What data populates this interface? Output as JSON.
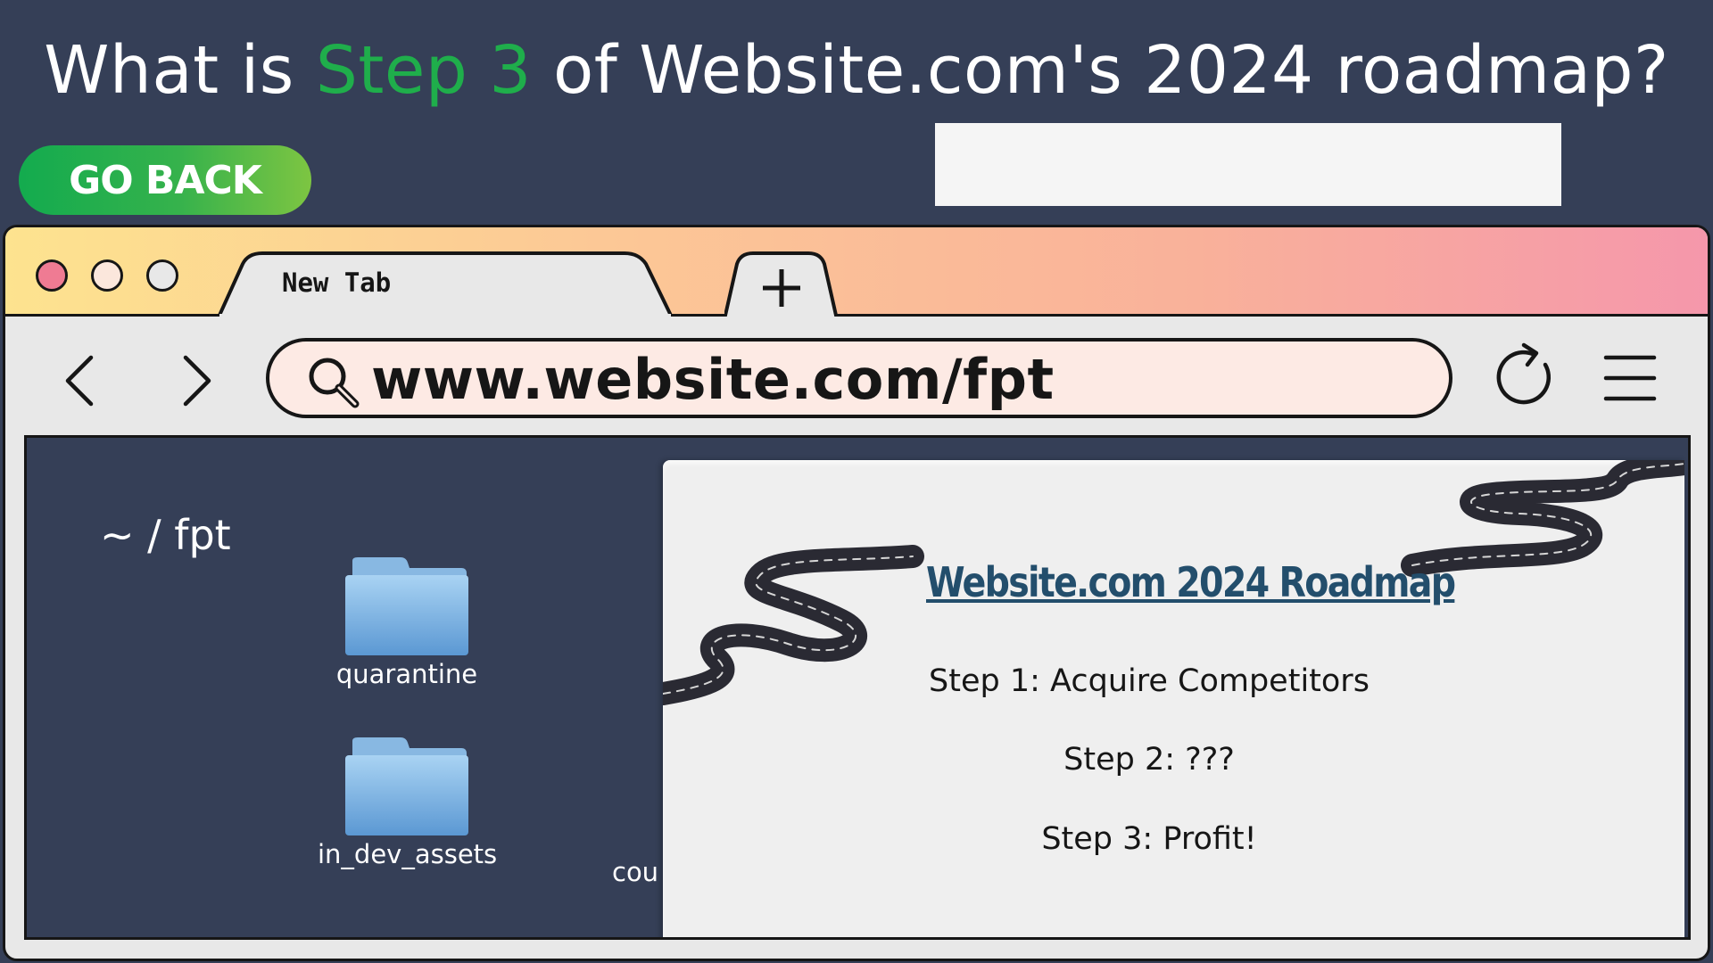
{
  "question": {
    "prefix": "What is ",
    "highlight": "Step 3",
    "suffix": " of Website.com's 2024 roadmap?"
  },
  "go_back_label": "GO BACK",
  "colors": {
    "background": "#353f57",
    "highlight": "#1fae4b",
    "go_back": "#1fa94e",
    "doc_title": "#234e6c",
    "close_dot": "#ef7b93"
  },
  "browser": {
    "tab_label": "New Tab",
    "new_tab_icon": "plus-icon",
    "url": "www.website.com/fpt",
    "icons": [
      "back-arrow-icon",
      "forward-arrow-icon",
      "search-icon",
      "reload-icon",
      "hamburger-menu-icon"
    ]
  },
  "file_browser": {
    "path": "~ / fpt",
    "folders": [
      {
        "name": "quarantine",
        "icon": "folder-icon"
      },
      {
        "name": "in_dev_assets",
        "icon": "folder-icon"
      }
    ],
    "partial_label": "cou"
  },
  "document": {
    "title": "Website.com 2024 Roadmap",
    "steps": [
      "Step 1: Acquire Competitors",
      "Step 2: ???",
      "Step 3: Profit!"
    ]
  }
}
